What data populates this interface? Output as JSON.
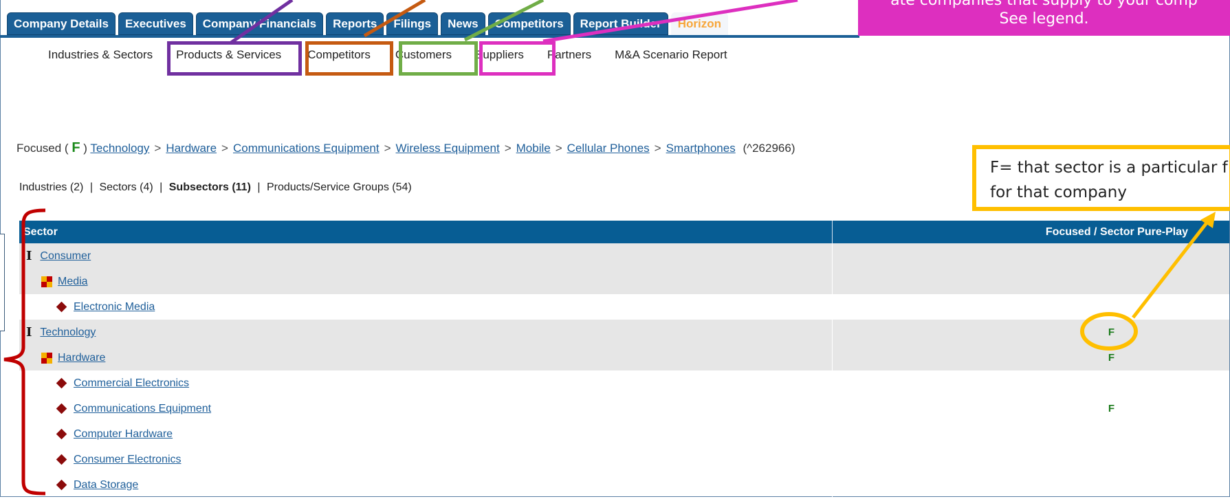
{
  "tabs": [
    {
      "label": "Company Details"
    },
    {
      "label": "Executives"
    },
    {
      "label": "Company Financials"
    },
    {
      "label": "Reports"
    },
    {
      "label": "Filings"
    },
    {
      "label": "News"
    },
    {
      "label": "Competitors"
    },
    {
      "label": "Report Builder"
    },
    {
      "label": "Horizon",
      "active": true
    }
  ],
  "subnav": [
    "Industries & Sectors",
    "Products & Services",
    "Competitors",
    "Customers",
    "Suppliers",
    "Partners",
    "M&A Scenario Report"
  ],
  "breadcrumb": {
    "prefix": "Focused (",
    "flag": "F",
    "suffix": ")",
    "links": [
      "Technology",
      "Hardware",
      "Communications Equipment",
      "Wireless Equipment",
      "Mobile",
      "Cellular Phones",
      "Smartphones"
    ],
    "separator": ">",
    "code": "(^262966)"
  },
  "counts": {
    "industries": "Industries (2)",
    "sep1": "|",
    "sectors": "Sectors (4)",
    "sep2": "|",
    "subsectors": "Subsectors (11)",
    "sep3": "|",
    "groups": "Products/Service Groups (54)"
  },
  "table": {
    "col1": "Sector",
    "col2": "Focused / Sector Pure-Play",
    "rows": [
      {
        "level": 1,
        "label": "Consumer",
        "flag": "",
        "shade": true
      },
      {
        "level": 2,
        "label": "Media",
        "flag": "",
        "shade": true
      },
      {
        "level": 3,
        "label": "Electronic Media",
        "flag": "",
        "shade": false
      },
      {
        "level": 1,
        "label": "Technology",
        "flag": "F",
        "shade": true
      },
      {
        "level": 2,
        "label": "Hardware",
        "flag": "F",
        "shade": true
      },
      {
        "level": 3,
        "label": "Commercial Electronics",
        "flag": "",
        "shade": false
      },
      {
        "level": 3,
        "label": "Communications Equipment",
        "flag": "F",
        "shade": false
      },
      {
        "level": 3,
        "label": "Computer Hardware",
        "flag": "",
        "shade": false
      },
      {
        "level": 3,
        "label": "Consumer Electronics",
        "flag": "",
        "shade": false
      },
      {
        "level": 3,
        "label": "Data Storage",
        "flag": "",
        "shade": false
      }
    ]
  },
  "callouts": {
    "pink_line1": "ate companies that supply to your comp",
    "pink_line2": "See legend.",
    "yellow_line1": "F= that sector is a particular f",
    "yellow_line2": "for that company"
  },
  "colors": {
    "tab_blue": "#1b5f96",
    "header_blue": "#075d94",
    "link": "#1f5f9a",
    "focus_green": "#1a8a1a",
    "purple": "#7030a0",
    "orange": "#c55a11",
    "green": "#70ad47",
    "magenta": "#dd2fbf",
    "yellow": "#ffbf00",
    "bracket_red": "#c00000"
  },
  "icons": {
    "industry": "i-beam-icon",
    "sector": "four-square-icon",
    "subsector": "diamond-icon"
  }
}
